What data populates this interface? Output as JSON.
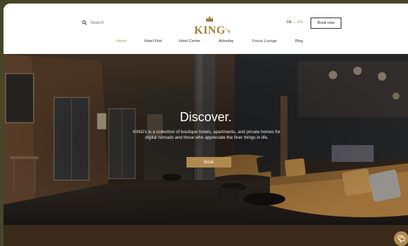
{
  "header": {
    "search_label": "Search",
    "logo_text": "KING",
    "logo_suffix": "'s",
    "lang_de": "DE",
    "lang_sep": "|",
    "lang_en": "EN",
    "book_label": "Book now"
  },
  "nav": {
    "items": [
      {
        "label": "Home",
        "active": true
      },
      {
        "label": "Hotel First",
        "active": false
      },
      {
        "label": "Hotel Center",
        "active": false
      },
      {
        "label": "Adveday",
        "active": false
      },
      {
        "label": "Focus Lounge",
        "active": false
      },
      {
        "label": "Blog",
        "active": false
      }
    ]
  },
  "hero": {
    "title": "Discover.",
    "text": "KING's is a collection of boutique hotels, apartments, and private homes for digital nomads and those who appreciate the finer things in life.",
    "button_label": "Book"
  },
  "colors": {
    "accent": "#b08a4f",
    "frame": "#46452a",
    "footer": "#3b2a1c"
  },
  "icons": {
    "search": "search-icon",
    "crown": "crown-icon",
    "chat": "chat-icon"
  }
}
